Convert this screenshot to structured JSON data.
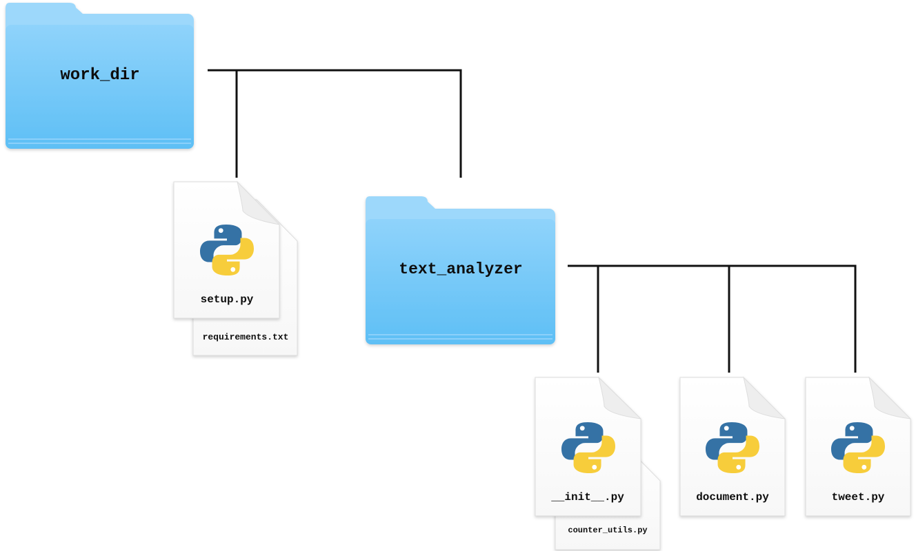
{
  "tree": {
    "root": {
      "name": "work_dir",
      "type": "folder",
      "children": [
        {
          "name": "setup.py",
          "type": "python-file"
        },
        {
          "name": "requirements.txt",
          "type": "text-file"
        },
        {
          "name": "text_analyzer",
          "type": "folder",
          "children": [
            {
              "name": "__init__.py",
              "type": "python-file"
            },
            {
              "name": "counter_utils.py",
              "type": "text-file"
            },
            {
              "name": "document.py",
              "type": "python-file"
            },
            {
              "name": "tweet.py",
              "type": "python-file"
            }
          ]
        }
      ]
    }
  },
  "labels": {
    "work_dir": "work_dir",
    "setup_py": "setup.py",
    "requirements_txt": "requirements.txt",
    "text_analyzer": "text_analyzer",
    "init_py": "__init__.py",
    "counter_utils_py": "counter_utils.py",
    "document_py": "document.py",
    "tweet_py": "tweet.py"
  },
  "colors": {
    "folder_top": "#8ad1fb",
    "folder_bottom": "#5fc0f6",
    "folder_tab": "#9ed8fb",
    "connector": "#111111",
    "python_blue": "#3572a5",
    "python_yellow": "#f7cd3b"
  }
}
